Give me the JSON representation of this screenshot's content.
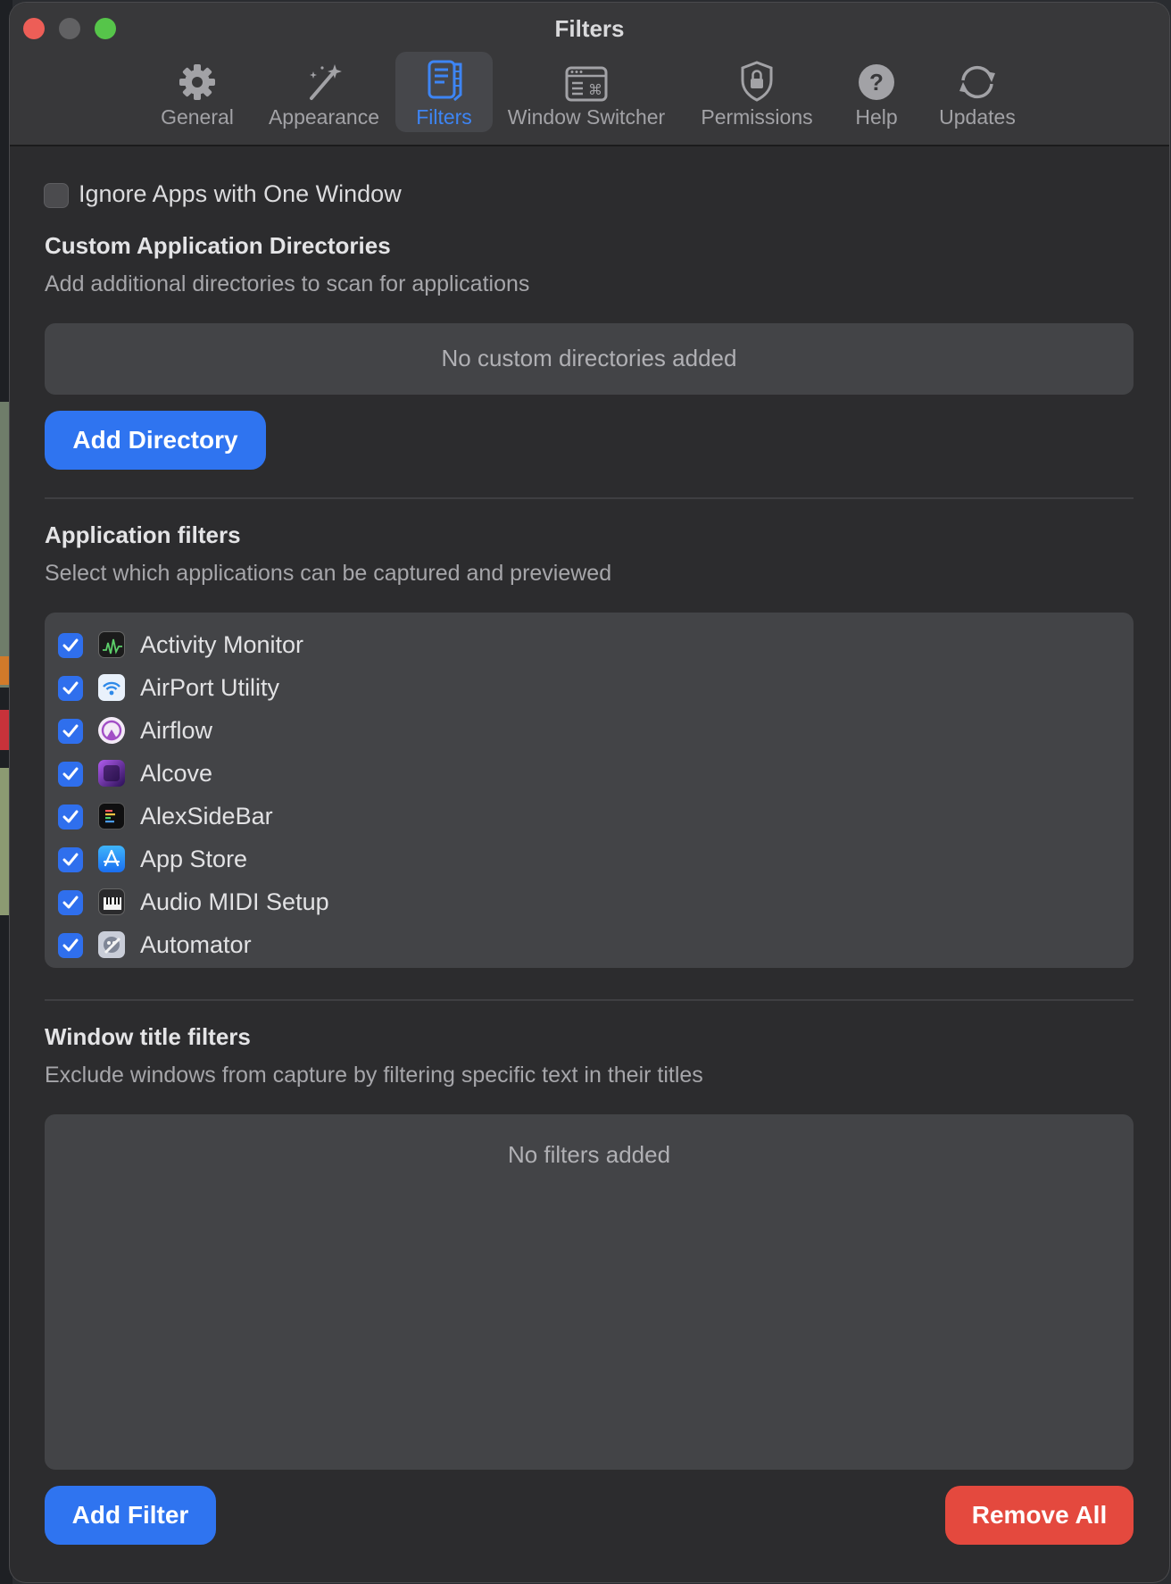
{
  "window": {
    "title": "Filters"
  },
  "colors": {
    "accent": "#3d85f5",
    "button_blue": "#2f74f0",
    "button_red": "#e4493e",
    "close": "#ed5e57",
    "minimize": "#616163",
    "maximize": "#56c54a"
  },
  "toolbar": {
    "tabs": [
      {
        "label": "General",
        "icon": "gear-icon"
      },
      {
        "label": "Appearance",
        "icon": "magic-wand-icon"
      },
      {
        "label": "Filters",
        "icon": "filter-document-icon",
        "active": true
      },
      {
        "label": "Window Switcher",
        "icon": "window-command-icon"
      },
      {
        "label": "Permissions",
        "icon": "shield-lock-icon"
      },
      {
        "label": "Help",
        "icon": "question-icon"
      },
      {
        "label": "Updates",
        "icon": "refresh-icon"
      }
    ]
  },
  "options": {
    "ignore_single_window": {
      "label": "Ignore Apps with One Window",
      "checked": false
    }
  },
  "directories": {
    "title": "Custom Application Directories",
    "description": "Add additional directories to scan for applications",
    "empty_text": "No custom directories added",
    "add_label": "Add Directory"
  },
  "app_filters": {
    "title": "Application filters",
    "description": "Select which applications can be captured and previewed",
    "apps": [
      {
        "name": "Activity Monitor",
        "checked": true,
        "icon": "activity-monitor-icon"
      },
      {
        "name": "AirPort Utility",
        "checked": true,
        "icon": "airport-utility-icon"
      },
      {
        "name": "Airflow",
        "checked": true,
        "icon": "airflow-icon"
      },
      {
        "name": "Alcove",
        "checked": true,
        "icon": "alcove-icon"
      },
      {
        "name": "AlexSideBar",
        "checked": true,
        "icon": "alexsidebar-icon"
      },
      {
        "name": "App Store",
        "checked": true,
        "icon": "app-store-icon"
      },
      {
        "name": "Audio MIDI Setup",
        "checked": true,
        "icon": "audio-midi-icon"
      },
      {
        "name": "Automator",
        "checked": true,
        "icon": "automator-icon"
      }
    ]
  },
  "title_filters": {
    "title": "Window title filters",
    "description": "Exclude windows from capture by filtering specific text in their titles",
    "empty_text": "No filters added",
    "add_label": "Add Filter",
    "remove_label": "Remove All"
  }
}
